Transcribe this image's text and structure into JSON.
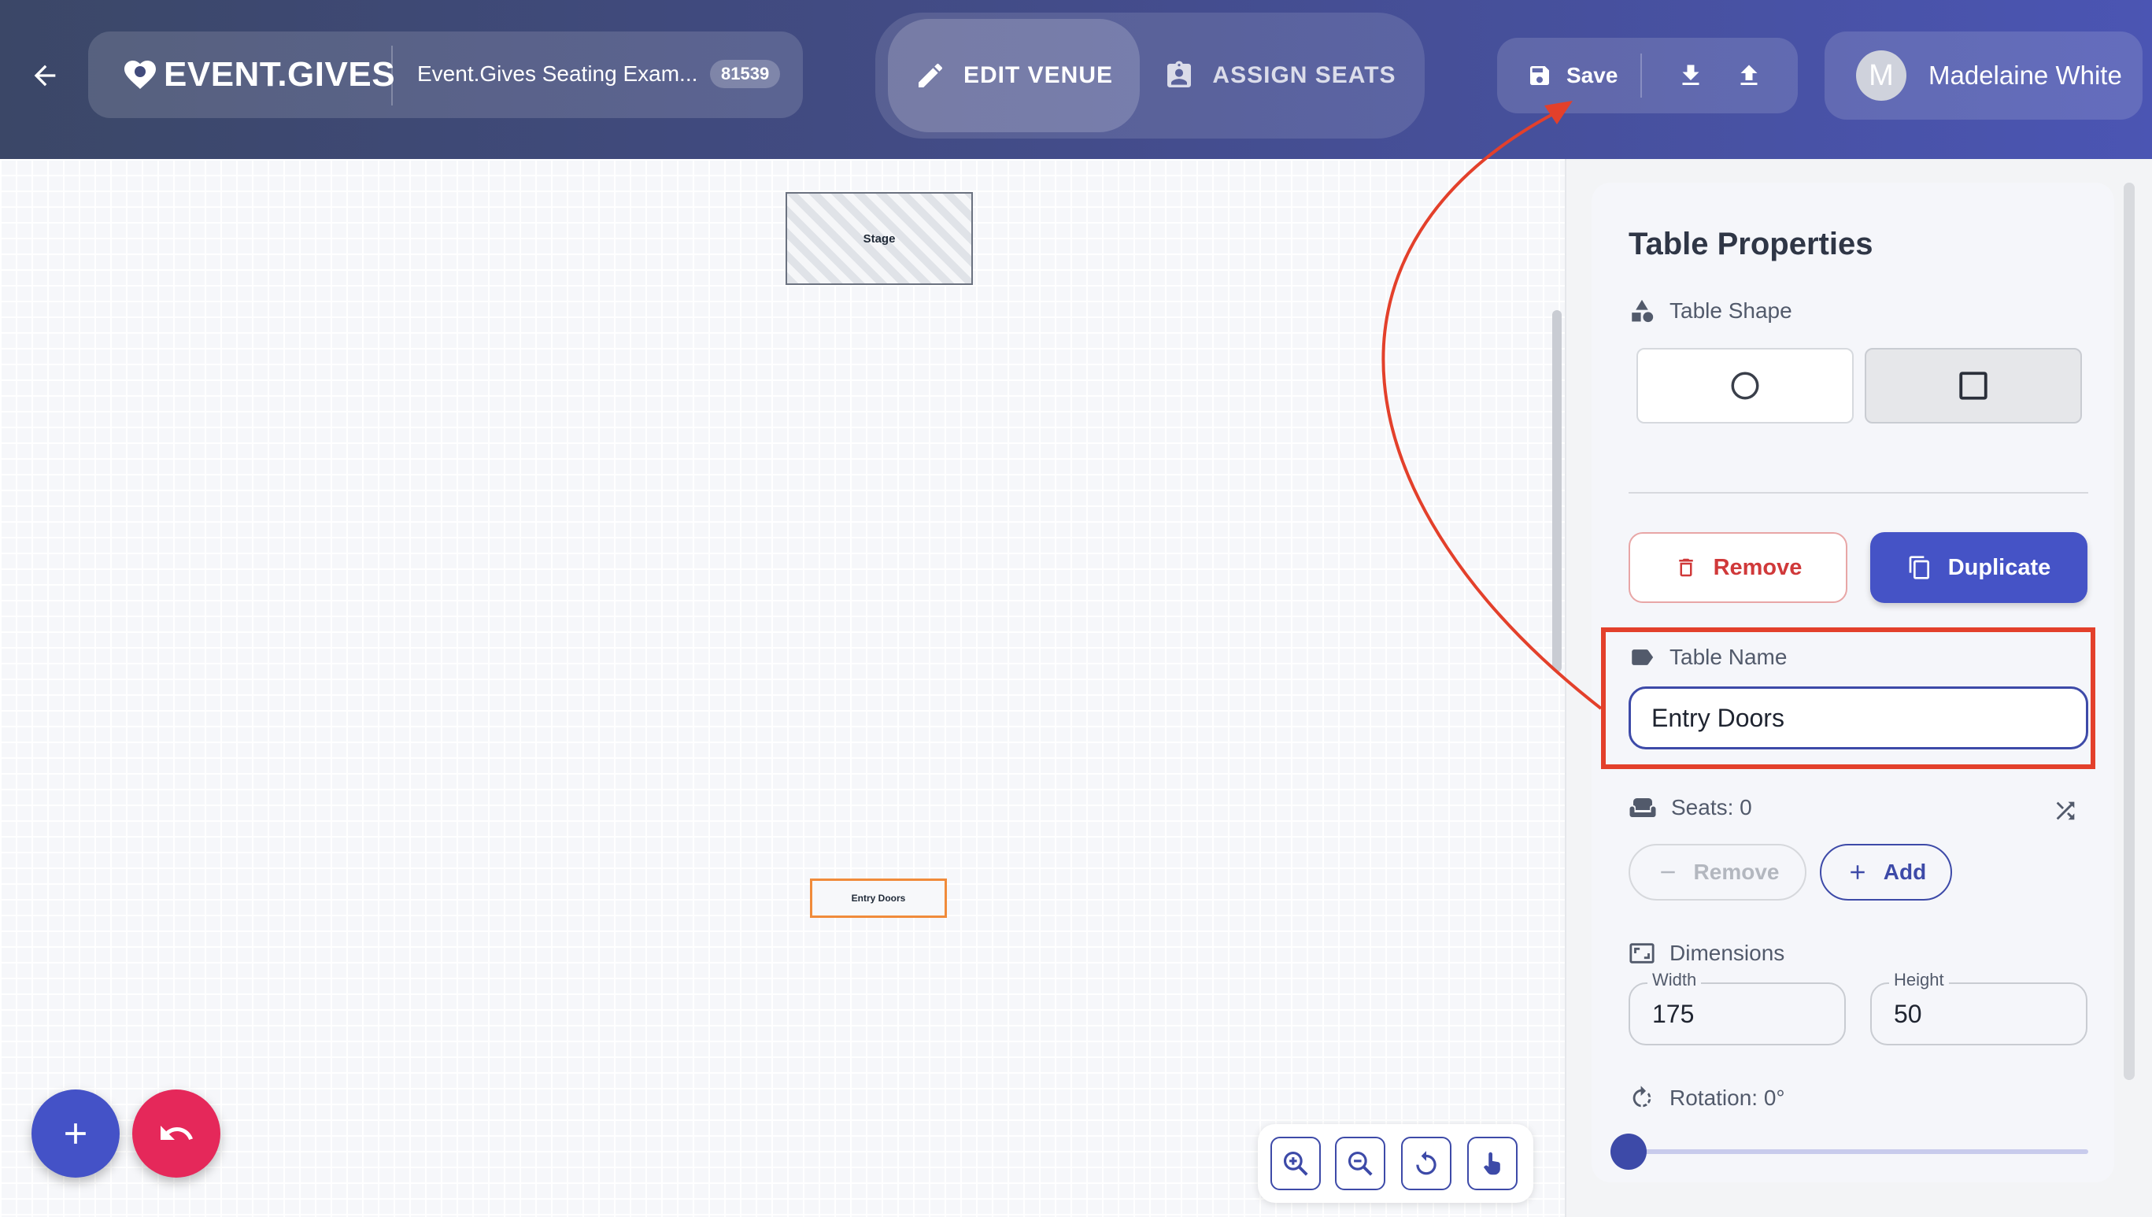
{
  "header": {
    "brand": "EVENT.GIVES",
    "event_title": "Event.Gives Seating Exam...",
    "event_id": "81539",
    "modes": {
      "edit": "EDIT VENUE",
      "assign": "ASSIGN SEATS"
    },
    "active_mode": "edit",
    "save_label": "Save",
    "user": {
      "initial": "M",
      "name": "Madelaine White"
    },
    "icons": [
      "arrow-left-icon",
      "heart-logo-icon",
      "pencil-icon",
      "badge-icon",
      "floppy-disk-icon",
      "download-icon",
      "upload-icon"
    ]
  },
  "canvas": {
    "objects": [
      {
        "label": "Stage",
        "type": "stage"
      },
      {
        "label": "Entry Doors",
        "type": "table",
        "selected": true
      }
    ],
    "zoom_controls": [
      "zoom-in-icon",
      "zoom-out-icon",
      "reset-rotate-icon",
      "pan-hand-icon"
    ],
    "fab": [
      "plus-icon",
      "undo-icon"
    ]
  },
  "panel": {
    "title": "Table Properties",
    "table_shape": {
      "label": "Table Shape",
      "options": [
        "circle",
        "square"
      ],
      "selected": "square"
    },
    "remove_label": "Remove",
    "duplicate_label": "Duplicate",
    "table_name": {
      "label": "Table Name",
      "value": "Entry Doors"
    },
    "seats": {
      "label": "Seats: 0",
      "remove_label": "Remove",
      "add_label": "Add"
    },
    "dimensions": {
      "label": "Dimensions",
      "width_label": "Width",
      "width": "175",
      "height_label": "Height",
      "height": "50"
    },
    "rotation": {
      "label": "Rotation: 0°",
      "value": 0,
      "max": 360
    }
  },
  "colors": {
    "accent": "#3d4aa8",
    "primary_button": "#4553c6",
    "danger": "#d0393a",
    "fab_undo": "#e5285a",
    "annotation": "#e3402b",
    "selected_outline": "#f08b3a"
  }
}
